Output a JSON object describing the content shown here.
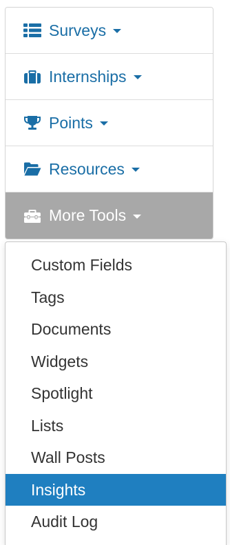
{
  "nav": {
    "items": [
      {
        "label": "Surveys",
        "icon": "list-icon"
      },
      {
        "label": "Internships",
        "icon": "briefcase-icon"
      },
      {
        "label": "Points",
        "icon": "trophy-icon"
      },
      {
        "label": "Resources",
        "icon": "folder-open-icon"
      },
      {
        "label": "More Tools",
        "icon": "toolbox-icon",
        "active": true
      }
    ]
  },
  "dropdown": {
    "items": [
      {
        "label": "Custom Fields"
      },
      {
        "label": "Tags"
      },
      {
        "label": "Documents"
      },
      {
        "label": "Widgets"
      },
      {
        "label": "Spotlight"
      },
      {
        "label": "Lists"
      },
      {
        "label": "Wall Posts"
      },
      {
        "label": "Insights",
        "highlighted": true
      },
      {
        "label": "Audit Log"
      }
    ]
  },
  "colors": {
    "link": "#1a6ea6",
    "active_bg": "#a8a8a8",
    "highlight_bg": "#1f7fc0",
    "menu_text": "#333333"
  }
}
